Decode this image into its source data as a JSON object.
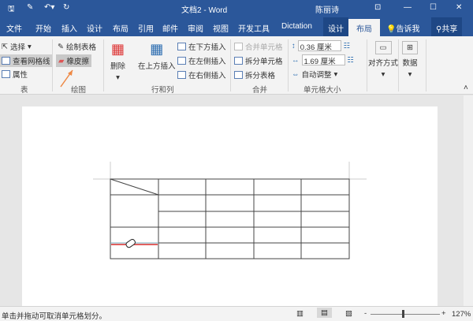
{
  "title": {
    "doc": "文档2 - Word",
    "user": "陈丽诗"
  },
  "tabs": [
    "文件",
    "开始",
    "插入",
    "设计",
    "布局",
    "引用",
    "邮件",
    "审阅",
    "视图",
    "开发工具",
    "Dictation",
    "设计",
    "布局"
  ],
  "tell_me": "告诉我",
  "share": "共享",
  "ribbon": {
    "table": {
      "select": "选择",
      "gridlines": "查看网格线",
      "properties": "属性",
      "label": "表"
    },
    "draw": {
      "draw_table": "绘制表格",
      "eraser": "橡皮擦",
      "label": "绘图"
    },
    "rows_cols": {
      "delete": "删除",
      "insert_above": "在上方插入",
      "insert_below": "在下方插入",
      "insert_left": "在左侧插入",
      "insert_right": "在右侧插入",
      "label": "行和列"
    },
    "merge": {
      "merge_cells": "合并单元格",
      "split_cells": "拆分单元格",
      "split_table": "拆分表格",
      "label": "合并"
    },
    "cell_size": {
      "height": "0.36 厘米",
      "width": "1.69 厘米",
      "autofit": "自动调整",
      "label": "单元格大小"
    },
    "alignment": "对齐方式",
    "data": "数据"
  },
  "status": {
    "message": "单击并拖动可取消单元格划分。",
    "zoom": "127%"
  }
}
